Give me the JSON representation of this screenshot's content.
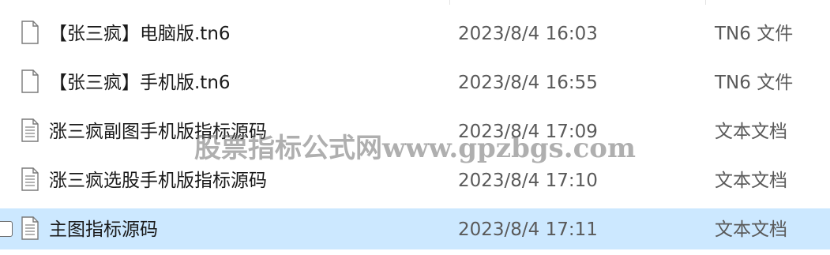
{
  "files": [
    {
      "name": "【张三疯】电脑版.tn6",
      "date": "2023/8/4 16:03",
      "type": "TN6 文件",
      "icon": "blank-file-icon",
      "selected": false
    },
    {
      "name": "【张三疯】手机版.tn6",
      "date": "2023/8/4 16:55",
      "type": "TN6 文件",
      "icon": "blank-file-icon",
      "selected": false
    },
    {
      "name": "涨三疯副图手机版指标源码",
      "date": "2023/8/4 17:09",
      "type": "文本文档",
      "icon": "text-file-icon",
      "selected": false
    },
    {
      "name": "涨三疯选股手机版指标源码",
      "date": "2023/8/4 17:10",
      "type": "文本文档",
      "icon": "text-file-icon",
      "selected": false
    },
    {
      "name": "主图指标源码",
      "date": "2023/8/4 17:11",
      "type": "文本文档",
      "icon": "text-file-icon",
      "selected": true
    }
  ],
  "watermark": "股票指标公式网www.gpzbgs.com",
  "colors": {
    "selection": "#cce8ff",
    "text": "#1a1a1a",
    "secondary_text": "#5a5a5a"
  }
}
